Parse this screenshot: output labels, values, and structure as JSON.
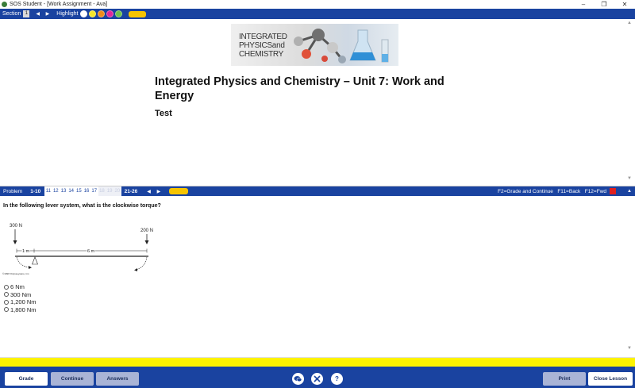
{
  "window": {
    "title": "SOS Student - [Work Assignment - Ava]",
    "controls": [
      "–",
      "❐",
      "✕"
    ]
  },
  "section_bar": {
    "section_label": "Section",
    "section_number": "1",
    "arrows": "◀ ▶",
    "highlight_label": "Highlight",
    "highlight_colors": [
      "#ffffff",
      "#f5e52a",
      "#f08c1a",
      "#e0279a",
      "#6cc24a"
    ]
  },
  "content": {
    "banner": {
      "line1": "INTEGRATED",
      "line2": "PHYSICSand",
      "line3": "CHEMISTRY"
    },
    "title": "Integrated Physics and Chemistry – Unit 7: Work and Energy",
    "subtitle": "Test"
  },
  "problem_bar": {
    "label": "Problem",
    "range_left": "1-10",
    "numbers": [
      "11",
      "12",
      "13",
      "14",
      "15",
      "16",
      "17",
      "18",
      "19",
      "20"
    ],
    "dim_numbers": [
      "18",
      "19",
      "20"
    ],
    "range_right": "21-26",
    "arrows": "◀ ▶",
    "shortcuts": "F2=Grade and Continue   F11=Back   F12=Fwd"
  },
  "question": {
    "text": "In the following lever system, what is the clockwise torque?",
    "diagram": {
      "left_force": "300 N",
      "right_force": "200 N",
      "left_distance": "1 m",
      "right_distance": "6 m",
      "copyright": "©1998 Odysseyware, Inc."
    },
    "choices": [
      "6 Nm",
      "300 Nm",
      "1,200 Nm",
      "1,800 Nm"
    ]
  },
  "footer": {
    "grade": "Grade",
    "continue": "Continue",
    "answers": "Answers",
    "print": "Print",
    "close_lesson": "Close Lesson",
    "icons": [
      "chat-icon",
      "tools-icon",
      "help-icon"
    ]
  }
}
